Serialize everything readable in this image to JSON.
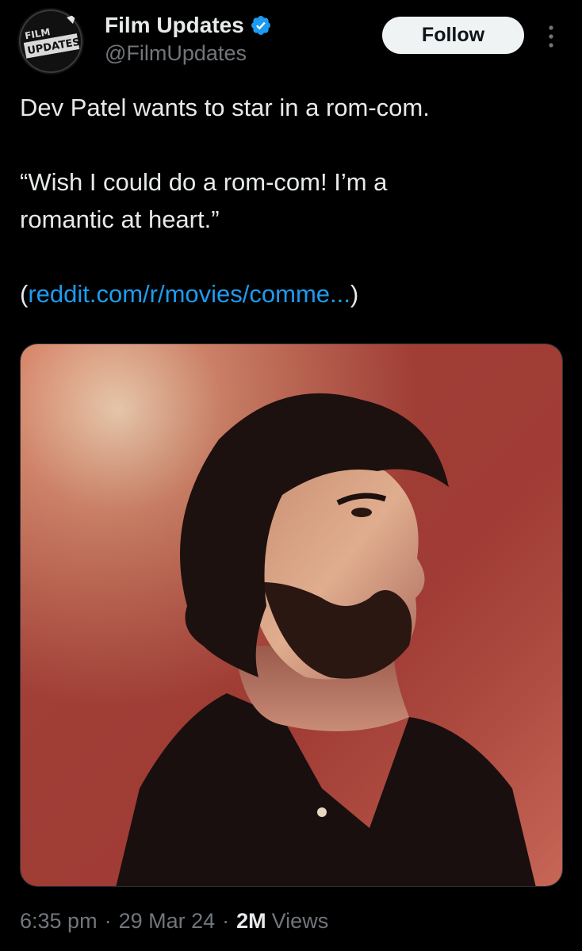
{
  "author": {
    "display_name": "Film Updates",
    "handle": "@FilmUpdates",
    "verified": true,
    "avatar_text": "FILM UPDATES"
  },
  "actions": {
    "follow_label": "Follow",
    "more_icon": "vertical-ellipsis-icon"
  },
  "tweet": {
    "line1": "Dev Patel wants to star in a rom-com.",
    "quote_line1": "“Wish I could do a rom-com! I’m a",
    "quote_line2": "romantic at heart.”",
    "link_open": "(",
    "link_text": "reddit.com/r/movies/comme...",
    "link_close": ")"
  },
  "media": {
    "description_icon": "photo-image"
  },
  "meta": {
    "time": "6:35 pm",
    "separator": "·",
    "date": "29 Mar 24",
    "views_count": "2M",
    "views_label": "Views"
  },
  "colors": {
    "background": "#000000",
    "text_primary": "#e7e9ea",
    "text_secondary": "#71767b",
    "link": "#1d9bf0",
    "verified_badge": "#1d9bf0",
    "follow_button_bg": "#eff3f4"
  }
}
